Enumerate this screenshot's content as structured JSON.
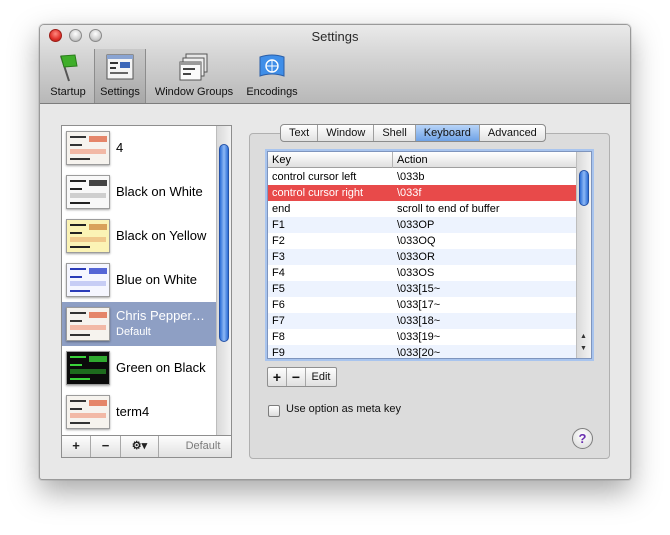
{
  "window": {
    "title": "Settings"
  },
  "toolbar": {
    "items": [
      {
        "label": "Startup",
        "icon": "flag-icon"
      },
      {
        "label": "Settings",
        "icon": "settings-icon",
        "selected": true
      },
      {
        "label": "Window Groups",
        "icon": "window-groups-icon"
      },
      {
        "label": "Encodings",
        "icon": "globe-flag-icon"
      }
    ]
  },
  "profiles": {
    "items": [
      {
        "name": "4",
        "subtitle": "",
        "theme": "mixed"
      },
      {
        "name": "Black on White",
        "subtitle": "",
        "theme": "light"
      },
      {
        "name": "Black on Yellow",
        "subtitle": "",
        "theme": "yellow"
      },
      {
        "name": "Blue on White",
        "subtitle": "",
        "theme": "blue"
      },
      {
        "name": "Chris Pepper…",
        "subtitle": "Default",
        "theme": "mixed",
        "selected": true
      },
      {
        "name": "Green on Black",
        "subtitle": "",
        "theme": "green"
      },
      {
        "name": "term4",
        "subtitle": "",
        "theme": "mixed"
      }
    ],
    "bottom_bar": {
      "add": "+",
      "remove": "−",
      "actions": "⚙▾",
      "default": "Default"
    }
  },
  "tabs": [
    {
      "label": "Text"
    },
    {
      "label": "Window"
    },
    {
      "label": "Shell"
    },
    {
      "label": "Keyboard",
      "active": true
    },
    {
      "label": "Advanced"
    }
  ],
  "keyboard_table": {
    "columns": {
      "key": "Key",
      "action": "Action"
    },
    "rows": [
      {
        "key": "control cursor left",
        "action": "\\033b"
      },
      {
        "key": "control cursor right",
        "action": "\\033f",
        "selected": true
      },
      {
        "key": "end",
        "action": "scroll to end of buffer"
      },
      {
        "key": "F1",
        "action": "\\033OP"
      },
      {
        "key": "F2",
        "action": "\\033OQ"
      },
      {
        "key": "F3",
        "action": "\\033OR"
      },
      {
        "key": "F4",
        "action": "\\033OS"
      },
      {
        "key": "F5",
        "action": "\\033[15~"
      },
      {
        "key": "F6",
        "action": "\\033[17~"
      },
      {
        "key": "F7",
        "action": "\\033[18~"
      },
      {
        "key": "F8",
        "action": "\\033[19~"
      },
      {
        "key": "F9",
        "action": "\\033[20~"
      }
    ]
  },
  "table_buttons": {
    "add": "+",
    "remove": "−",
    "edit": "Edit"
  },
  "meta_option": {
    "label": "Use option as meta key",
    "checked": false
  },
  "help": {
    "label": "?"
  },
  "colors": {
    "selection_red": "#e84a4a",
    "selected_profile": "#8e9fc4",
    "scroll_blue": "#2e6fd6"
  }
}
